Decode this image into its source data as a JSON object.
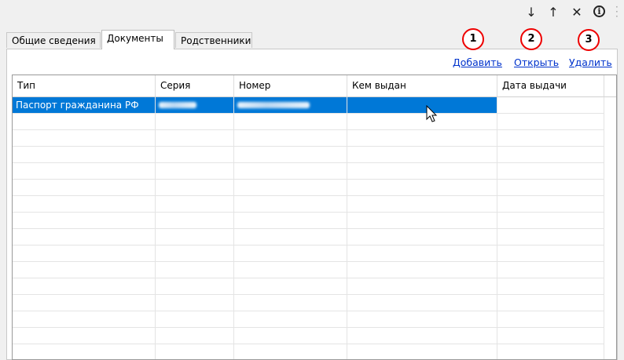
{
  "toolbar": {
    "icons": [
      "arrow-down-icon",
      "arrow-up-icon",
      "close-icon",
      "info-icon"
    ],
    "down_glyph": "↓",
    "up_glyph": "↑",
    "close_glyph": "✕",
    "info_glyph": "i"
  },
  "tabs": [
    {
      "label": "Общие сведения",
      "active": false
    },
    {
      "label": "Документы",
      "active": true
    },
    {
      "label": "Родственники",
      "active": false
    }
  ],
  "actions": {
    "add_label": "Добавить",
    "open_label": "Открыть",
    "delete_label": "Удалить"
  },
  "badges": [
    "1",
    "2",
    "3"
  ],
  "grid": {
    "columns": [
      "Тип",
      "Серия",
      "Номер",
      "Кем выдан",
      "Дата выдачи"
    ],
    "rows": [
      {
        "type": "Паспорт гражданина РФ",
        "series": "",
        "number": "",
        "issued_by": "",
        "issue_date": ""
      }
    ]
  },
  "colors": {
    "selection": "#0078d7",
    "link": "#0033cc",
    "badge_border": "#e00000"
  }
}
